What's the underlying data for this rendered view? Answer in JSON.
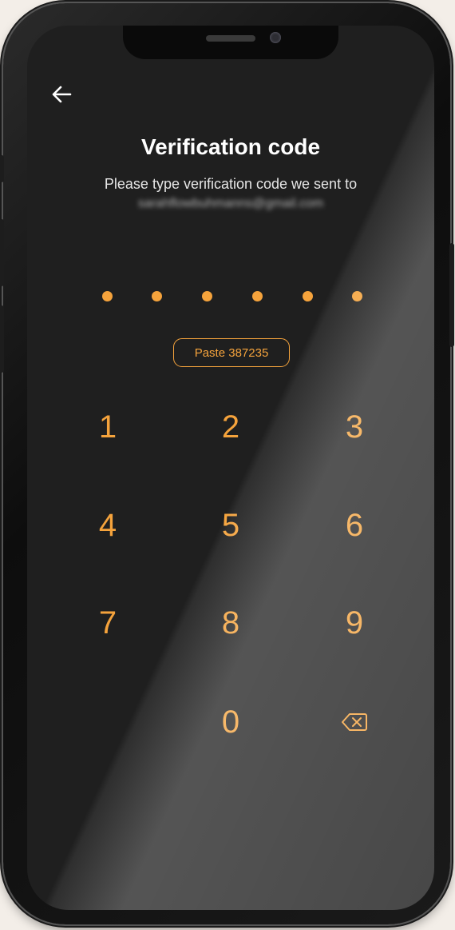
{
  "header": {
    "back_icon": "arrow-left-icon",
    "title": "Verification code",
    "subtitle": "Please type verification code we sent to",
    "email": "sarahflowbuhmanns@gmail.com"
  },
  "code_input": {
    "length": 6,
    "filled": 0
  },
  "paste_button": {
    "label": "Paste 387235"
  },
  "keypad": {
    "keys": [
      "1",
      "2",
      "3",
      "4",
      "5",
      "6",
      "7",
      "8",
      "9",
      "0"
    ],
    "backspace_icon": "backspace-icon"
  },
  "colors": {
    "accent": "#F5A33C",
    "background": "#1F1F1F",
    "text": "#FFFFFF"
  }
}
